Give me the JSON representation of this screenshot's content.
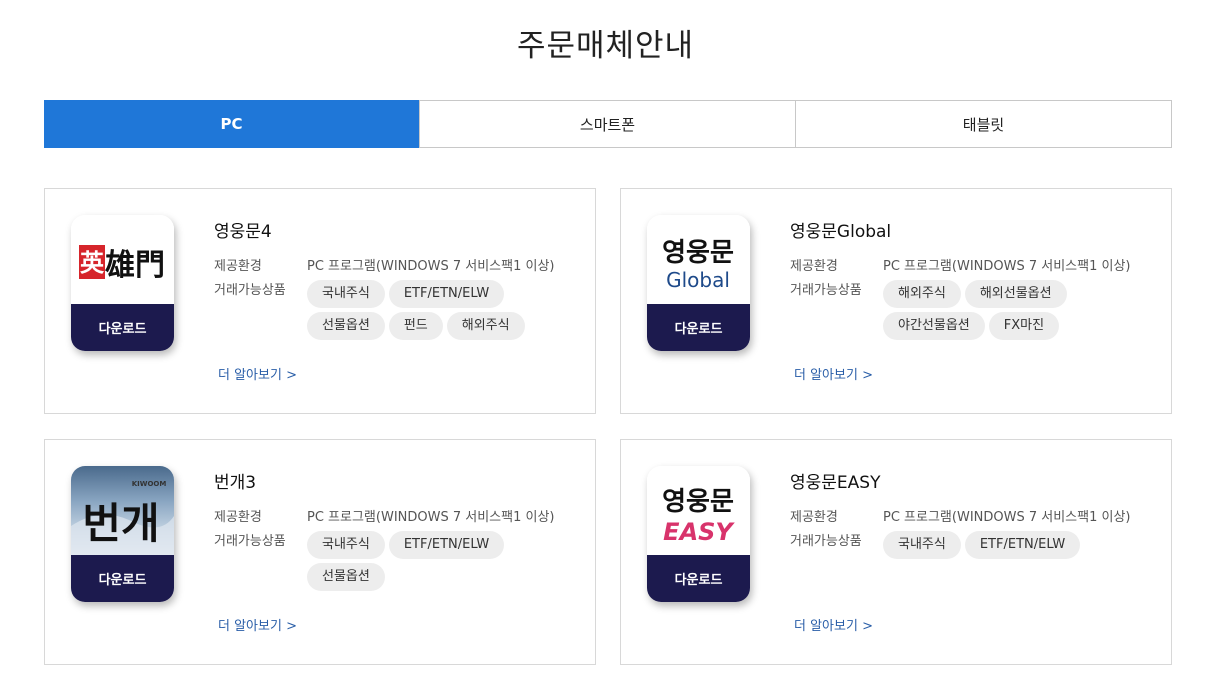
{
  "title": "주문매체안내",
  "tabs": [
    {
      "label": "PC",
      "active": true
    },
    {
      "label": "스마트폰",
      "active": false
    },
    {
      "label": "태블릿",
      "active": false
    }
  ],
  "labels": {
    "env": "제공환경",
    "products": "거래가능상품",
    "download": "다운로드",
    "more": "더 알아보기 >"
  },
  "cards": [
    {
      "name": "영웅문4",
      "env": "PC 프로그램(WINDOWS 7 서비스팩1 이상)",
      "products": [
        "국내주식",
        "ETF/ETN/ELW",
        "선물옵션",
        "펀드",
        "해외주식"
      ],
      "icon": "youngwoongmun-logo",
      "icon_text": "英雄門"
    },
    {
      "name": "영웅문Global",
      "env": "PC 프로그램(WINDOWS 7 서비스팩1 이상)",
      "products": [
        "해외주식",
        "해외선물옵션",
        "야간선물옵션",
        "FX마진"
      ],
      "icon": "youngwoongmun-global-logo",
      "icon_text": "영웅문",
      "icon_sub": "Global"
    },
    {
      "name": "번개3",
      "env": "PC 프로그램(WINDOWS 7 서비스팩1 이상)",
      "products": [
        "국내주식",
        "ETF/ETN/ELW",
        "선물옵션"
      ],
      "icon": "beongae-logo",
      "icon_text": "번개",
      "icon_sub": "KIWOOM"
    },
    {
      "name": "영웅문EASY",
      "env": "PC 프로그램(WINDOWS 7 서비스팩1 이상)",
      "products": [
        "국내주식",
        "ETF/ETN/ELW"
      ],
      "icon": "youngwoongmun-easy-logo",
      "icon_text": "영웅문",
      "icon_sub": "EASY"
    }
  ],
  "colors": {
    "active_tab": "#1f77d8",
    "download_bg": "#1c1a4e",
    "link": "#2a5ea8",
    "logo_red": "#d6252b",
    "global_blue": "#1e4a8a",
    "easy_pink": "#d8336b"
  }
}
